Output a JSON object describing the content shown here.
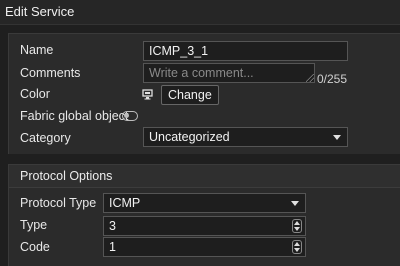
{
  "dialog": {
    "title": "Edit Service"
  },
  "general": {
    "name_label": "Name",
    "name_value": "ICMP_3_1",
    "comments_label": "Comments",
    "comments_placeholder": "Write a comment...",
    "comments_counter": "0/255",
    "color_label": "Color",
    "color_icon": "monitor-icon",
    "change_button": "Change",
    "fabric_label": "Fabric global object",
    "fabric_toggle": "off",
    "category_label": "Category",
    "category_value": "Uncategorized"
  },
  "protocol_options": {
    "header": "Protocol Options",
    "protocol_type_label": "Protocol Type",
    "protocol_type_value": "ICMP",
    "type_label": "Type",
    "type_value": "3",
    "code_label": "Code",
    "code_value": "1"
  }
}
